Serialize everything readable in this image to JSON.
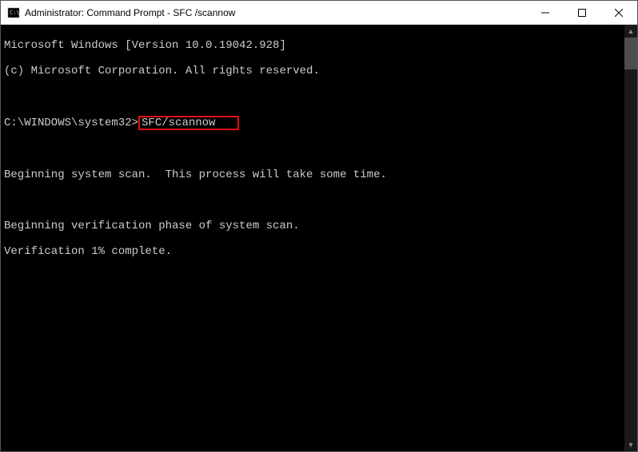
{
  "titlebar": {
    "title": "Administrator: Command Prompt - SFC /scannow"
  },
  "terminal": {
    "line1": "Microsoft Windows [Version 10.0.19042.928]",
    "line2": "(c) Microsoft Corporation. All rights reserved.",
    "prompt": "C:\\WINDOWS\\system32>",
    "command": "SFC/scannow",
    "scan1": "Beginning system scan.  This process will take some time.",
    "scan2": "Beginning verification phase of system scan.",
    "scan3": "Verification 1% complete."
  }
}
